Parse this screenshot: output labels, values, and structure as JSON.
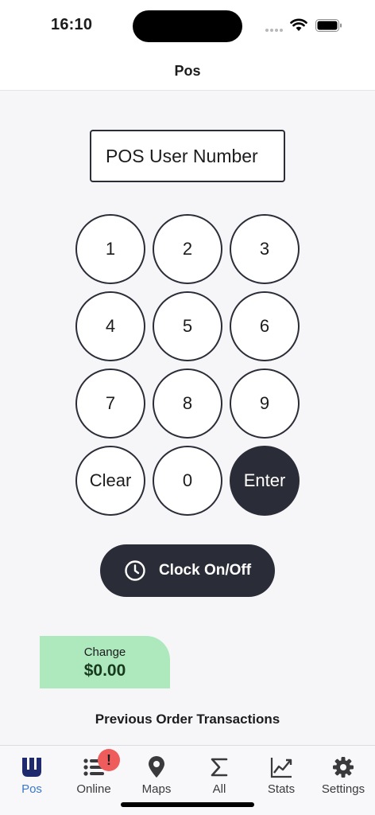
{
  "status_bar": {
    "time": "16:10"
  },
  "nav": {
    "title": "Pos"
  },
  "user_input": {
    "placeholder": "POS User Number",
    "value": ""
  },
  "keypad": {
    "keys": [
      "1",
      "2",
      "3",
      "4",
      "5",
      "6",
      "7",
      "8",
      "9",
      "Clear",
      "0",
      "Enter"
    ]
  },
  "clock_button": {
    "label": "Clock On/Off",
    "icon": "clock-icon"
  },
  "change": {
    "label": "Change",
    "amount": "$0.00"
  },
  "previous_orders": {
    "title": "Previous Order Transactions"
  },
  "tab_bar": {
    "items": [
      {
        "label": "Pos",
        "icon": "pos-logo-icon",
        "active": true
      },
      {
        "label": "Online",
        "icon": "list-icon",
        "badge": "!"
      },
      {
        "label": "Maps",
        "icon": "map-pin-icon"
      },
      {
        "label": "All",
        "icon": "sigma-icon"
      },
      {
        "label": "Stats",
        "icon": "chart-icon"
      },
      {
        "label": "Settings",
        "icon": "gear-icon"
      }
    ]
  },
  "colors": {
    "primary_dark": "#2a2d37",
    "active_tab": "#3b78c8",
    "change_bg": "#ade9bc",
    "badge": "#ef5c5c"
  }
}
